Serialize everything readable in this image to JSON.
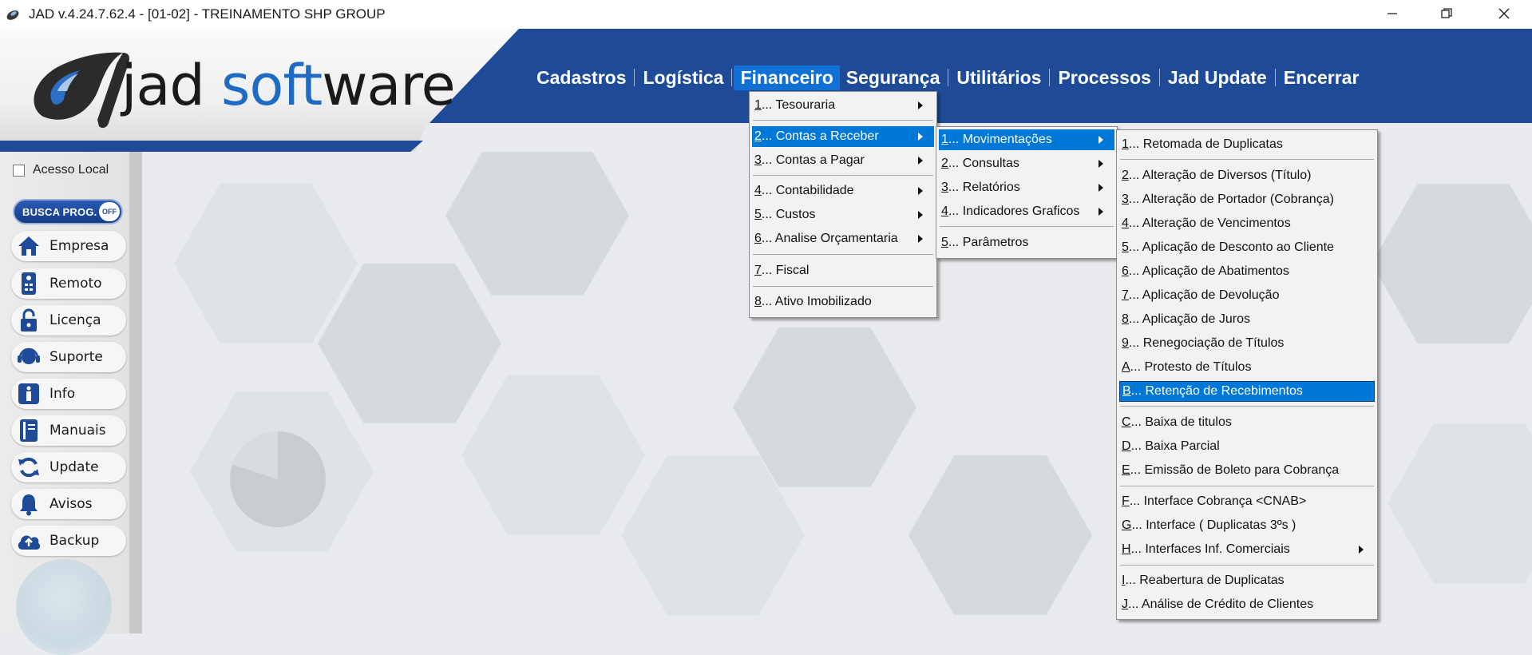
{
  "window": {
    "title": "JAD v.4.24.7.62.4 - [01-02] - TREINAMENTO SHP GROUP"
  },
  "logo": {
    "text_part1": "jad ",
    "text_part2": "soft",
    "text_part3": "ware"
  },
  "topmenu": {
    "items": [
      "Cadastros",
      "Logística",
      "Financeiro",
      "Segurança",
      "Utilitários",
      "Processos",
      "Jad Update",
      "Encerrar"
    ],
    "active": "Financeiro"
  },
  "sidebar": {
    "acesso_local": "Acesso Local",
    "busca_label": "BUSCA PROG.",
    "busca_toggle": "OFF",
    "buttons": [
      "Empresa",
      "Remoto",
      "Licença",
      "Suporte",
      "Info",
      "Manuais",
      "Update",
      "Avisos",
      "Backup"
    ]
  },
  "financeiro_menu": {
    "items": [
      {
        "key": "1",
        "label": "... Tesouraria"
      },
      {
        "key": "2",
        "label": "... Contas a Receber"
      },
      {
        "key": "3",
        "label": "... Contas a Pagar"
      },
      {
        "key": "4",
        "label": "... Contabilidade"
      },
      {
        "key": "5",
        "label": "... Custos"
      },
      {
        "key": "6",
        "label": "... Analise Orçamentaria"
      },
      {
        "key": "7",
        "label": "... Fiscal"
      },
      {
        "key": "8",
        "label": "... Ativo Imobilizado"
      }
    ]
  },
  "contas_receber_menu": {
    "items": [
      {
        "key": "1",
        "label": "... Movimentações"
      },
      {
        "key": "2",
        "label": "... Consultas"
      },
      {
        "key": "3",
        "label": "... Relatórios"
      },
      {
        "key": "4",
        "label": "... Indicadores Graficos"
      },
      {
        "key": "5",
        "label": "... Parâmetros"
      }
    ]
  },
  "movimentacoes_menu": {
    "items": [
      {
        "key": "1",
        "label": "... Retomada de Duplicatas"
      },
      {
        "key": "2",
        "label": "... Alteração de Diversos (Título)"
      },
      {
        "key": "3",
        "label": "... Alteração de Portador (Cobrança)"
      },
      {
        "key": "4",
        "label": "... Alteração de Vencimentos"
      },
      {
        "key": "5",
        "label": "... Aplicação de Desconto ao Cliente"
      },
      {
        "key": "6",
        "label": "... Aplicação de Abatimentos"
      },
      {
        "key": "7",
        "label": "... Aplicação de Devolução"
      },
      {
        "key": "8",
        "label": "... Aplicação de Juros"
      },
      {
        "key": "9",
        "label": "... Renegociação de Títulos"
      },
      {
        "key": "A",
        "label": "... Protesto de Títulos"
      },
      {
        "key": "B",
        "label": "... Retenção de Recebimentos"
      },
      {
        "key": "C",
        "label": "... Baixa de titulos"
      },
      {
        "key": "D",
        "label": "... Baixa Parcial"
      },
      {
        "key": "E",
        "label": "... Emissão de Boleto para Cobrança"
      },
      {
        "key": "F",
        "label": "... Interface Cobrança <CNAB>"
      },
      {
        "key": "G",
        "label": "... Interface ( Duplicatas 3ºs )"
      },
      {
        "key": "H",
        "label": "... Interfaces Inf. Comerciais"
      },
      {
        "key": "I",
        "label": "... Reabertura de Duplicatas"
      },
      {
        "key": "J",
        "label": "... Análise de Crédito de Clientes"
      }
    ]
  },
  "colors": {
    "header_blue": "#1e4a97",
    "menu_highlight": "#0078d7"
  }
}
